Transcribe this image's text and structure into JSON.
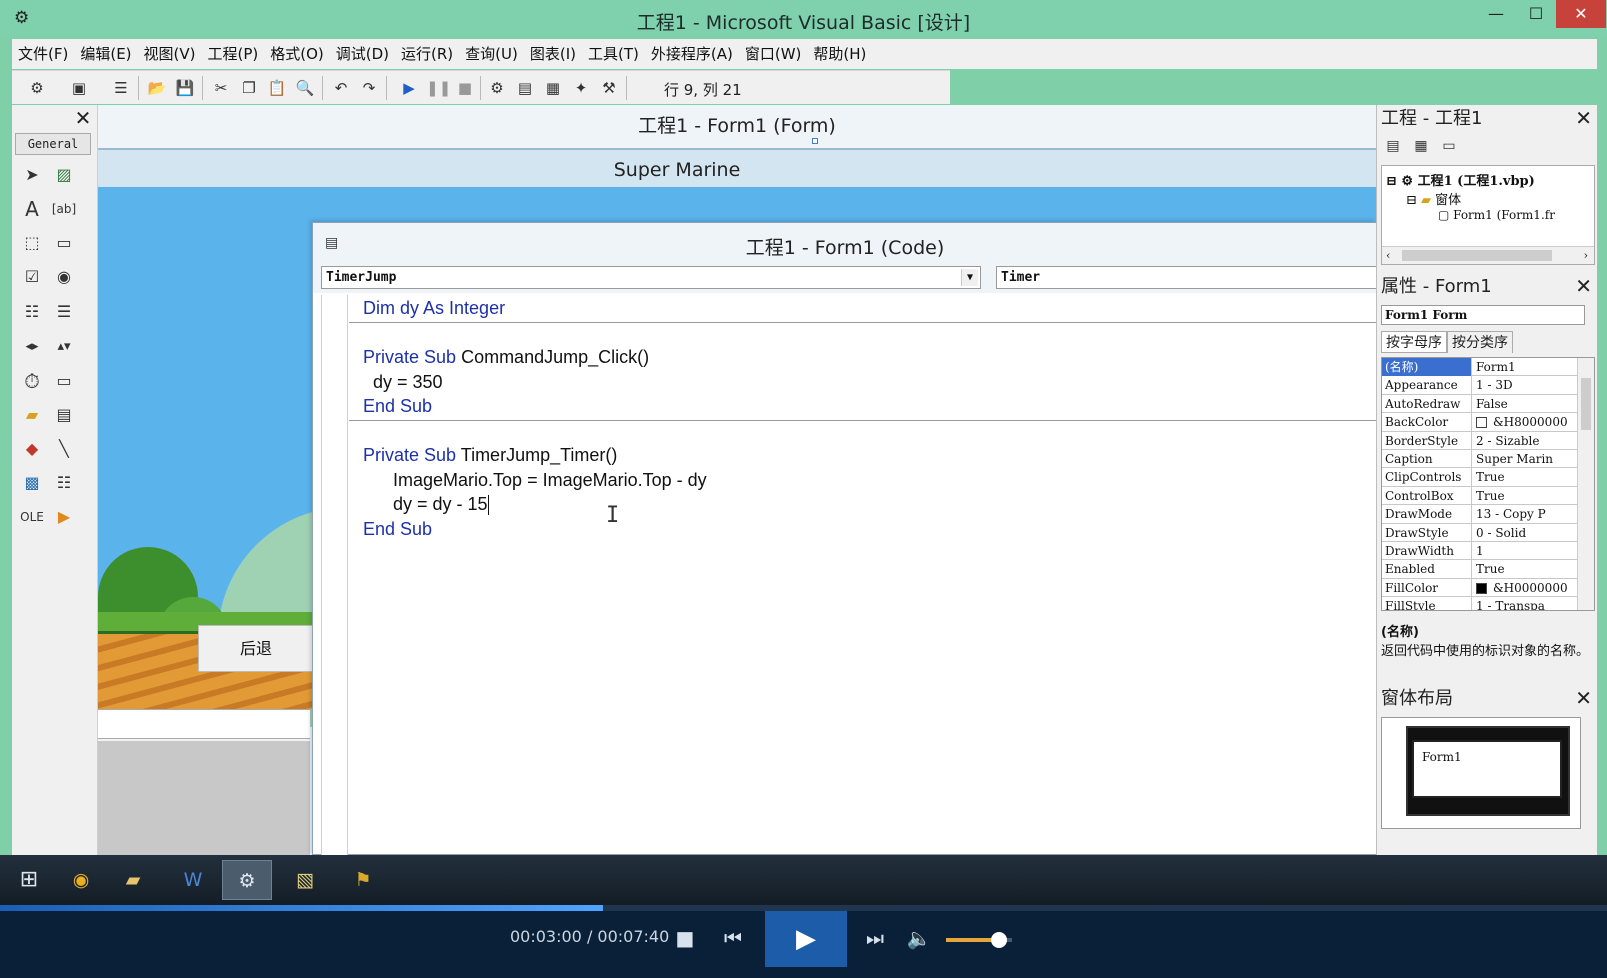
{
  "window": {
    "title": "工程1 - Microsoft Visual Basic [设计]",
    "min_glyph": "—",
    "max_glyph": "☐",
    "close_glyph": "✕"
  },
  "menu": [
    "文件(F)",
    "编辑(E)",
    "视图(V)",
    "工程(P)",
    "格式(O)",
    "调试(D)",
    "运行(R)",
    "查询(U)",
    "图表(I)",
    "工具(T)",
    "外接程序(A)",
    "窗口(W)",
    "帮助(H)"
  ],
  "toolbar": {
    "cursor_position": "行 9, 列 21"
  },
  "toolbox": {
    "tab": "General",
    "close_glyph": "✕"
  },
  "form": {
    "window_title": "工程1 - Form1 (Form)",
    "caption": "Super Marine",
    "back_button": "后退"
  },
  "code": {
    "window_title": "工程1 - Form1 (Code)",
    "object_combo": "TimerJump",
    "procedure_combo": "Timer",
    "lines": [
      {
        "keyword": "Dim",
        "text": " dy ",
        "keyword2": "As Integer"
      },
      {
        "keyword": "Private Sub",
        "text": " CommandJump_Click()"
      },
      {
        "text": "  dy = 350"
      },
      {
        "keyword": "End Sub"
      },
      {
        "keyword": "Private Sub",
        "text": " TimerJump_Timer()"
      },
      {
        "text": "      ImageMario.Top = ImageMario.Top - dy"
      },
      {
        "text": "      dy = dy - 15"
      },
      {
        "keyword": "End Sub"
      }
    ]
  },
  "project": {
    "title": "工程 - 工程1",
    "root": "工程1 (工程1.vbp)",
    "folder": "窗体",
    "form_node": "Form1 (Form1.fr"
  },
  "properties": {
    "title": "属性 - Form1",
    "object": "Form1 Form",
    "tab_alpha": "按字母序",
    "tab_category": "按分类序",
    "rows": [
      {
        "name": "(名称)",
        "value": "Form1"
      },
      {
        "name": "Appearance",
        "value": "1 - 3D"
      },
      {
        "name": "AutoRedraw",
        "value": "False"
      },
      {
        "name": "BackColor",
        "value": "&H8000000",
        "swatch": "#ffffff"
      },
      {
        "name": "BorderStyle",
        "value": "2 - Sizable"
      },
      {
        "name": "Caption",
        "value": "Super Marin"
      },
      {
        "name": "ClipControls",
        "value": "True"
      },
      {
        "name": "ControlBox",
        "value": "True"
      },
      {
        "name": "DrawMode",
        "value": "13 - Copy P"
      },
      {
        "name": "DrawStyle",
        "value": "0 - Solid"
      },
      {
        "name": "DrawWidth",
        "value": "1"
      },
      {
        "name": "Enabled",
        "value": "True"
      },
      {
        "name": "FillColor",
        "value": "&H0000000",
        "swatch": "#000000"
      },
      {
        "name": "FillStyle",
        "value": "1 - Transpa"
      }
    ],
    "desc_name": "(名称)",
    "desc_text": "返回代码中使用的标识对象的名称。"
  },
  "layout_panel": {
    "title": "窗体布局",
    "form_label": "Form1"
  },
  "player": {
    "time": "00:03:00 / 00:07:40",
    "progress": 0.375,
    "volume": 0.8
  }
}
